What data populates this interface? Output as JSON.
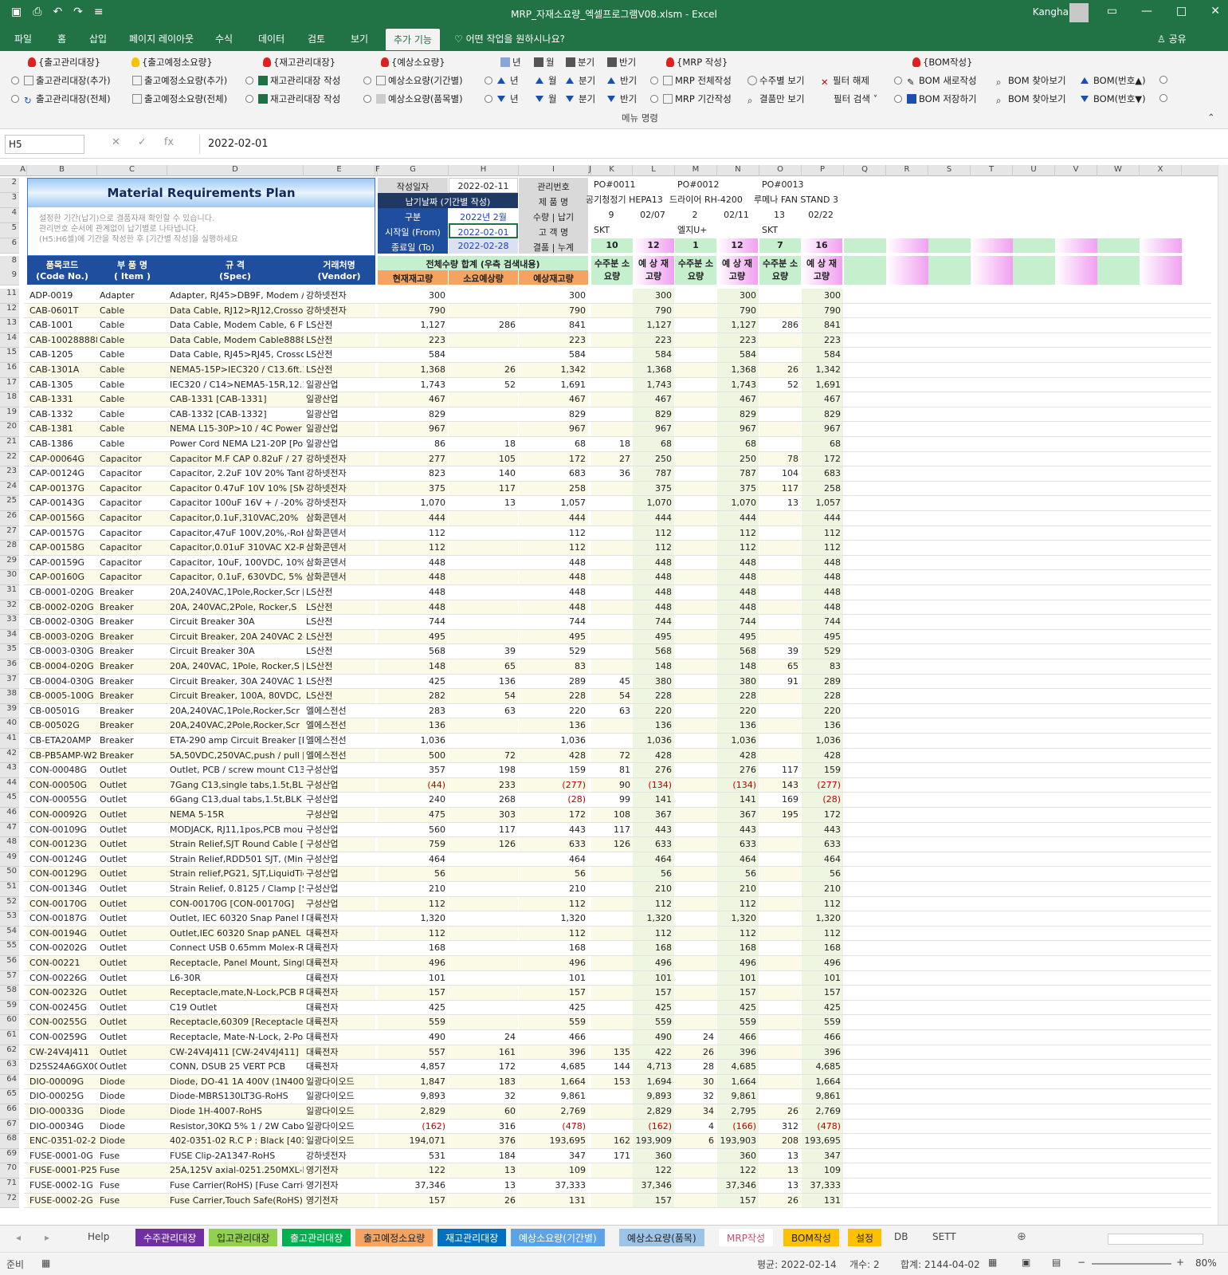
{
  "window": {
    "title": "MRP_자재소요량_엑셀프로그램V08.xlsm  -  Excel",
    "user": "Kangha"
  },
  "tabs": [
    "파일",
    "홈",
    "삽입",
    "페이지 레이아웃",
    "수식",
    "데이터",
    "검토",
    "보기",
    "추가 기능"
  ],
  "active_tab": "추가 기능",
  "tell_me": "어떤 작업을 원하시나요?",
  "share": "공유",
  "ribbon": {
    "group_label": "메뉴 명령",
    "row1": [
      "{출고관리대장}",
      "{출고예정소요량}",
      "{재고관리대장}",
      "{예상소요량}",
      "년",
      "월",
      "분기",
      "반기",
      "{MRP 작성}",
      "{BOM작성}"
    ],
    "row2": [
      "출고관리대장(추가)",
      "출고예정소요량(추가)",
      "재고관리대장 작성",
      "예상소요량(기간별)",
      "년",
      "월",
      "분기",
      "반기",
      "MRP 전체작성",
      "수주별 보기",
      "필터 해제",
      "BOM 새로작성",
      "BOM 찾아보기",
      "BOM(번호▲)"
    ],
    "row3": [
      "출고관리대장(전체)",
      "출고예정소요량(전체)",
      "재고관리대장 작성",
      "예상소요량(품목별)",
      "년",
      "월",
      "분기",
      "반기",
      "MRP 기간작성",
      "결품만 보기",
      "필터 검색 ˅",
      "BOM 저장하기",
      "BOM 찾아보기",
      "BOM(번호▼)"
    ]
  },
  "formula": {
    "name_box": "H5",
    "value": "2022-02-01"
  },
  "columns": [
    "A",
    "B",
    "C",
    "D",
    "E",
    "F",
    "G",
    "H",
    "I",
    "J",
    "K",
    "L",
    "M",
    "N",
    "O",
    "P",
    "Q",
    "R",
    "S",
    "T",
    "U",
    "V",
    "W",
    "X"
  ],
  "plan": {
    "title": "Material Requirements Plan",
    "desc1": "설정한 기간(납기)으로 결품자재 확인할 수 있습니다.",
    "desc2": "관리번호 순서에 관계없이 납기별로 나타냅니다.",
    "desc3": "(H5:H6셀)에 기간을 작성한 후 [기간별 작성]을 실행하세요",
    "created_lbl": "작성일자",
    "created": "2022-02-11",
    "period_btn": "납기날짜 (기간별 작성)",
    "kind_lbl": "구분",
    "kind": "2022년 2월",
    "from_lbl": "시작일 (From)",
    "from": "2022-02-01",
    "to_lbl": "종료일 (To)",
    "to": "2022-02-28",
    "mgmt_lbl": "관리번호",
    "prod_lbl": "제 품 명",
    "qty_lbl": "수량 | 납기",
    "cust_lbl": "고 객 명",
    "short_lbl": "결품 | 누계"
  },
  "orders": [
    {
      "po": "PO#0011",
      "product": "공기청정기 HEPA13",
      "qty": "9",
      "due": "02/07",
      "cust": "SKT",
      "short": "10",
      "cum": "12"
    },
    {
      "po": "PO#0012",
      "product": "드라이어 RH-4200",
      "qty": "2",
      "due": "02/11",
      "cust": "엘지U+",
      "short": "1",
      "cum": "12"
    },
    {
      "po": "PO#0013",
      "product": "루메나 FAN STAND 3",
      "qty": "13",
      "due": "02/22",
      "cust": "SKT",
      "short": "7",
      "cum": "16"
    }
  ],
  "headers": {
    "code": "품목코드",
    "code2": "(Code No.)",
    "item": "부 품 명",
    "item2": "( Item )",
    "spec": "규 격",
    "spec2": "(Spec)",
    "vendor": "거래처명",
    "vendor2": "(Vendor)",
    "total": "전체수량 합계 (우측 검색내용)",
    "cur": "현재재고량",
    "need": "소요예상량",
    "exp": "예상재고량",
    "ord_need1": "수주분",
    "ord_need2": "소요량",
    "ord_exp1": "예   상",
    "ord_exp2": "재고량"
  },
  "rows": [
    [
      "11",
      "ADP-0019",
      "Adapter",
      "Adapter, RJ45>DB9F, Modem / PC",
      "강하넷전자",
      "300",
      "",
      "300",
      "",
      "300",
      "",
      "300",
      "",
      "300"
    ],
    [
      "12",
      "CAB-0601T",
      "Cable",
      "Data Cable, RJ12>RJ12,Crossover",
      "강하넷전자",
      "790",
      "",
      "790",
      "",
      "790",
      "",
      "790",
      "",
      "790"
    ],
    [
      "13",
      "CAB-1001",
      "Cable",
      "Data Cable, Modem Cable, 6 Ft, [",
      "LS산전",
      "1,127",
      "286",
      "841",
      "",
      "1,127",
      "",
      "1,127",
      "286",
      "841"
    ],
    [
      "14",
      "CAB-1002888888",
      "Cable",
      "Data Cable, Modem Cable888888",
      "LS산전",
      "223",
      "",
      "223",
      "",
      "223",
      "",
      "223",
      "",
      "223"
    ],
    [
      "15",
      "CAB-1205",
      "Cable",
      "Data Cable, RJ45>RJ45, Crossove",
      "LS산전",
      "584",
      "",
      "584",
      "",
      "584",
      "",
      "584",
      "",
      "584"
    ],
    [
      "16",
      "CAB-1301A",
      "Cable",
      "NEMA5-15P>IEC320 / C13.6ft.10A",
      "LS산전",
      "1,368",
      "26",
      "1,342",
      "",
      "1,368",
      "",
      "1,368",
      "26",
      "1,342"
    ],
    [
      "17",
      "CAB-1305",
      "Cable",
      "IEC320 / C14>NEMA5-15R,12.10A",
      "일광산업",
      "1,743",
      "52",
      "1,691",
      "",
      "1,743",
      "",
      "1,743",
      "52",
      "1,691"
    ],
    [
      "18",
      "CAB-1331",
      "Cable",
      "CAB-1331 [CAB-1331]",
      "일광산업",
      "467",
      "",
      "467",
      "",
      "467",
      "",
      "467",
      "",
      "467"
    ],
    [
      "19",
      "CAB-1332",
      "Cable",
      "CAB-1332 [CAB-1332]",
      "일광산업",
      "829",
      "",
      "829",
      "",
      "829",
      "",
      "829",
      "",
      "829"
    ],
    [
      "20",
      "CAB-1381",
      "Cable",
      "NEMA L15-30P>10 / 4C Power Co",
      "일광산업",
      "967",
      "",
      "967",
      "",
      "967",
      "",
      "967",
      "",
      "967"
    ],
    [
      "21",
      "CAB-1386",
      "Cable",
      "Power Cord NEMA L21-20P [Powe",
      "일광산업",
      "86",
      "18",
      "68",
      "18",
      "68",
      "",
      "68",
      "",
      "68"
    ],
    [
      "22",
      "CAP-00064G",
      "Capacitor",
      "Capacitor M.F CAP 0.82uF / 275V-",
      "강하넷전자",
      "277",
      "105",
      "172",
      "27",
      "250",
      "",
      "250",
      "78",
      "172"
    ],
    [
      "23",
      "CAP-00124G",
      "Capacitor",
      "Capacitor, 2.2uF 10V 20% Tantalu",
      "강하넷전자",
      "823",
      "140",
      "683",
      "36",
      "787",
      "",
      "787",
      "104",
      "683"
    ],
    [
      "24",
      "CAP-00137G",
      "Capacitor",
      "Capacitor 0.47uF 10V 10% [SMT0",
      "강하넷전자",
      "375",
      "117",
      "258",
      "",
      "375",
      "",
      "375",
      "117",
      "258"
    ],
    [
      "25",
      "CAP-00143G",
      "Capacitor",
      "Capacitor 100uF 16V + / -20% 10",
      "강하넷전자",
      "1,070",
      "13",
      "1,057",
      "",
      "1,070",
      "",
      "1,070",
      "13",
      "1,057"
    ],
    [
      "26",
      "CAP-00156G",
      "Capacitor",
      "Capacitor,0.1uF,310VAC,20%",
      "삼화콘덴서",
      "444",
      "",
      "444",
      "",
      "444",
      "",
      "444",
      "",
      "444"
    ],
    [
      "27",
      "CAP-00157G",
      "Capacitor",
      "Capacitor,47uF 100V,20%,-RoHS",
      "삼화콘덴서",
      "112",
      "",
      "112",
      "",
      "112",
      "",
      "112",
      "",
      "112"
    ],
    [
      "28",
      "CAP-00158G",
      "Capacitor",
      "Capacitor,0.01uF 310VAC X2-RoH",
      "삼화콘덴서",
      "112",
      "",
      "112",
      "",
      "112",
      "",
      "112",
      "",
      "112"
    ],
    [
      "29",
      "CAP-00159G",
      "Capacitor",
      "Capacitor, 10uF, 100VDC, 10%, M",
      "삼화콘덴서",
      "448",
      "",
      "448",
      "",
      "448",
      "",
      "448",
      "",
      "448"
    ],
    [
      "30",
      "CAP-00160G",
      "Capacitor",
      "Capacitor, 0.1uF, 630VDC, 5%, Me",
      "삼화콘덴서",
      "448",
      "",
      "448",
      "",
      "448",
      "",
      "448",
      "",
      "448"
    ],
    [
      "31",
      "CB-0001-020G",
      "Breaker",
      "20A,240VAC,1Pole,Rocker,Scr [20A",
      "LS산전",
      "448",
      "",
      "448",
      "",
      "448",
      "",
      "448",
      "",
      "448"
    ],
    [
      "32",
      "CB-0002-020G",
      "Breaker",
      "20A, 240VAC,2Pole, Rocker,S",
      "LS산전",
      "448",
      "",
      "448",
      "",
      "448",
      "",
      "448",
      "",
      "448"
    ],
    [
      "33",
      "CB-0002-030G",
      "Breaker",
      "Circuit Breaker 30A",
      "LS산전",
      "744",
      "",
      "744",
      "",
      "744",
      "",
      "744",
      "",
      "744"
    ],
    [
      "34",
      "CB-0003-020G",
      "Breaker",
      "Circuit Breaker, 20A 240VAC 2-Po",
      "LS산전",
      "495",
      "",
      "495",
      "",
      "495",
      "",
      "495",
      "",
      "495"
    ],
    [
      "35",
      "CB-0003-030G",
      "Breaker",
      "Circuit Breaker 30A",
      "LS산전",
      "568",
      "39",
      "529",
      "",
      "568",
      "",
      "568",
      "39",
      "529"
    ],
    [
      "36",
      "CB-0004-020G",
      "Breaker",
      "20A, 240VAC, 1Pole, Rocker,S [20A",
      "LS산전",
      "148",
      "65",
      "83",
      "",
      "148",
      "",
      "148",
      "65",
      "83"
    ],
    [
      "37",
      "CB-0004-030G",
      "Breaker",
      "Circuit Breaker, 30A 240VAC 1-Po",
      "LS산전",
      "425",
      "136",
      "289",
      "45",
      "380",
      "",
      "380",
      "91",
      "289"
    ],
    [
      "38",
      "CB-0005-100G",
      "Breaker",
      "Circuit Breaker, 100A, 80VDC, 1 P",
      "LS산전",
      "282",
      "54",
      "228",
      "54",
      "228",
      "",
      "228",
      "",
      "228"
    ],
    [
      "39",
      "CB-00501G",
      "Breaker",
      "20A,240VAC,1Pole,Rocker,Scr",
      "엘에스전선",
      "283",
      "63",
      "220",
      "63",
      "220",
      "",
      "220",
      "",
      "220"
    ],
    [
      "40",
      "CB-00502G",
      "Breaker",
      "20A,240VAC,2Pole,Rocker,Scr",
      "엘에스전선",
      "136",
      "",
      "136",
      "",
      "136",
      "",
      "136",
      "",
      "136"
    ],
    [
      "41",
      "CB-ETA20AMP",
      "Breaker",
      "ETA-290 amp Circuit Breaker [ETA",
      "엘에스전선",
      "1,036",
      "",
      "1,036",
      "",
      "1,036",
      "",
      "1,036",
      "",
      "1,036"
    ],
    [
      "42",
      "CB-PB5AMP-W23",
      "Breaker",
      "5A,50VDC,250VAC,push / pull [Circ",
      "엘에스전선",
      "500",
      "72",
      "428",
      "72",
      "428",
      "",
      "428",
      "",
      "428"
    ],
    [
      "43",
      "CON-00048G",
      "Outlet",
      "Outlet, PCB / screw mount C13,10",
      "구성산업",
      "357",
      "198",
      "159",
      "81",
      "276",
      "",
      "276",
      "117",
      "159"
    ],
    [
      "44",
      "CON-00050G",
      "Outlet",
      "7Gang C13,single tabs,1.5t,BL [CO",
      "구성산업",
      "(44)",
      "233",
      "(277)",
      "90",
      "(134)",
      "",
      "(134)",
      "143",
      "(277)"
    ],
    [
      "45",
      "CON-00055G",
      "Outlet",
      "6Gang C13,dual tabs,1.5t,BLK [CO",
      "구성산업",
      "240",
      "268",
      "(28)",
      "99",
      "141",
      "",
      "141",
      "169",
      "(28)"
    ],
    [
      "46",
      "CON-00092G",
      "Outlet",
      "NEMA 5-15R",
      "구성산업",
      "475",
      "303",
      "172",
      "108",
      "367",
      "",
      "367",
      "195",
      "172"
    ],
    [
      "47",
      "CON-00109G",
      "Outlet",
      "MODJACK, RJ11,1pos,PCB mount-",
      "구성산업",
      "560",
      "117",
      "443",
      "117",
      "443",
      "",
      "443",
      "",
      "443"
    ],
    [
      "48",
      "CON-00123G",
      "Outlet",
      "Strain Relief,SJT Round Cable [CO",
      "구성산업",
      "759",
      "126",
      "633",
      "126",
      "633",
      "",
      "633",
      "",
      "633"
    ],
    [
      "49",
      "CON-00124G",
      "Outlet",
      "Strain Relief,RDD501 SJT, (Min Dia",
      "구성산업",
      "464",
      "",
      "464",
      "",
      "464",
      "",
      "464",
      "",
      "464"
    ],
    [
      "50",
      "CON-00129G",
      "Outlet",
      "Strain relief,PG21, SJT,LiquidTight,",
      "구성산업",
      "56",
      "",
      "56",
      "",
      "56",
      "",
      "56",
      "",
      "56"
    ],
    [
      "51",
      "CON-00134G",
      "Outlet",
      "Strain Relief, 0.8125 / Clamp [Stra",
      "구성산업",
      "210",
      "",
      "210",
      "",
      "210",
      "",
      "210",
      "",
      "210"
    ],
    [
      "52",
      "CON-00170G",
      "Outlet",
      "CON-00170G [CON-00170G]",
      "구성산업",
      "112",
      "",
      "112",
      "",
      "112",
      "",
      "112",
      "",
      "112"
    ],
    [
      "53",
      "CON-00187G",
      "Outlet",
      "Outlet, IEC 60320 Snap Panel Mo",
      "대륙전자",
      "1,320",
      "",
      "1,320",
      "",
      "1,320",
      "",
      "1,320",
      "",
      "1,320"
    ],
    [
      "54",
      "CON-00194G",
      "Outlet",
      "Outlet,IEC 60320 Snap pANEL [R3",
      "대륙전자",
      "112",
      "",
      "112",
      "",
      "112",
      "",
      "112",
      "",
      "112"
    ],
    [
      "55",
      "CON-00202G",
      "Outlet",
      "Connect USB 0.65mm Molex-RoH",
      "대륙전자",
      "168",
      "",
      "168",
      "",
      "168",
      "",
      "168",
      "",
      "168"
    ],
    [
      "56",
      "CON-00221",
      "Outlet",
      "Receptacle, Panel Mount, Single, .",
      "대륙전자",
      "496",
      "",
      "496",
      "",
      "496",
      "",
      "496",
      "",
      "496"
    ],
    [
      "57",
      "CON-00226G",
      "Outlet",
      "L6-30R",
      "대륙전자",
      "101",
      "",
      "101",
      "",
      "101",
      "",
      "101",
      "",
      "101"
    ],
    [
      "58",
      "CON-00232G",
      "Outlet",
      "Receptacle,mate,N-Lock,PCB Righ",
      "대륙전자",
      "157",
      "",
      "157",
      "",
      "157",
      "",
      "157",
      "",
      "157"
    ],
    [
      "59",
      "CON-00245G",
      "Outlet",
      "C19 Outlet",
      "대륙전자",
      "425",
      "",
      "425",
      "",
      "425",
      "",
      "425",
      "",
      "425"
    ],
    [
      "60",
      "CON-00255G",
      "Outlet",
      "Receptacle,60309 [Receptacle,603",
      "대륙전자",
      "559",
      "",
      "559",
      "",
      "559",
      "",
      "559",
      "",
      "559"
    ],
    [
      "61",
      "CON-00259G",
      "Outlet",
      "Receptacle, Mate-N-Lock, 2-Posit",
      "대륙전자",
      "490",
      "24",
      "466",
      "",
      "490",
      "24",
      "466",
      "",
      "466"
    ],
    [
      "62",
      "CW-24V4J411",
      "Outlet",
      "CW-24V4J411 [CW-24V4J411]",
      "대륙전자",
      "557",
      "161",
      "396",
      "135",
      "422",
      "26",
      "396",
      "",
      "396"
    ],
    [
      "63",
      "D25S24A6GX00LF",
      "Outlet",
      "CONN, DSUB 25 VERT PCB",
      "대륙전자",
      "4,857",
      "172",
      "4,685",
      "144",
      "4,713",
      "28",
      "4,685",
      "",
      "4,685"
    ],
    [
      "64",
      "DIO-00009G",
      "Diode",
      "Diode, DO-41 1A 400V (1N4004)-",
      "일광다이오드",
      "1,847",
      "183",
      "1,664",
      "153",
      "1,694",
      "30",
      "1,664",
      "",
      "1,664"
    ],
    [
      "65",
      "DIO-00025G",
      "Diode",
      "Diode-MBRS130LT3G-RoHS",
      "일광다이오드",
      "9,893",
      "32",
      "9,861",
      "",
      "9,893",
      "32",
      "9,861",
      "",
      "9,861"
    ],
    [
      "66",
      "DIO-00033G",
      "Diode",
      "Diode 1H-4007-RoHS",
      "일광다이오드",
      "2,829",
      "60",
      "2,769",
      "",
      "2,829",
      "34",
      "2,795",
      "26",
      "2,769"
    ],
    [
      "67",
      "DIO-00034G",
      "Diode",
      "Resistor,30KΩ 5% 1 / 2W Cabon",
      "일광다이오드",
      "(162)",
      "316",
      "(478)",
      "",
      "(162)",
      "4",
      "(166)",
      "312",
      "(478)"
    ],
    [
      "68",
      "ENC-0351-02-21",
      "Diode",
      "402-0351-02 R.C P : Black [403-0",
      "일광다이오드",
      "194,071",
      "376",
      "193,695",
      "162",
      "193,909",
      "6",
      "193,903",
      "208",
      "193,695"
    ],
    [
      "69",
      "FUSE-0001-0G",
      "Fuse",
      "FUSE Clip-2A1347-RoHS",
      "강하넷전자",
      "531",
      "184",
      "347",
      "171",
      "360",
      "",
      "360",
      "13",
      "347"
    ],
    [
      "70",
      "FUSE-0001-P25",
      "Fuse",
      "25A,125V axial-0251.250MXL-RoH",
      "영기전자",
      "122",
      "13",
      "109",
      "",
      "122",
      "",
      "122",
      "13",
      "109"
    ],
    [
      "71",
      "FUSE-0002-1G",
      "Fuse",
      "Fuse Carrier(RoHS) [Fuse Carrier]",
      "영기전자",
      "37,346",
      "13",
      "37,333",
      "",
      "37,346",
      "",
      "37,346",
      "13",
      "37,333"
    ],
    [
      "72",
      "FUSE-0002-2G",
      "Fuse",
      "Fuse Carrier,Touch Safe(RoHS) [Fu",
      "영기전자",
      "157",
      "26",
      "131",
      "",
      "157",
      "",
      "157",
      "26",
      "131"
    ]
  ],
  "sheets": [
    {
      "name": "Help",
      "color": "#f3f3f3",
      "fg": "#444"
    },
    {
      "name": "수주관리대장",
      "color": "#7030a0",
      "fg": "#fff"
    },
    {
      "name": "입고관리대장",
      "color": "#92d050",
      "fg": "#222"
    },
    {
      "name": "출고관리대장",
      "color": "#00b050",
      "fg": "#fff"
    },
    {
      "name": "출고예정소요량",
      "color": "#f4a460",
      "fg": "#222"
    },
    {
      "name": "재고관리대장",
      "color": "#0070c0",
      "fg": "#fff"
    },
    {
      "name": "예상소요량(기간별)",
      "color": "#5ba3e6",
      "fg": "#fff"
    },
    {
      "name": "예상소요량(품목)",
      "color": "#9dc3e6",
      "fg": "#222"
    },
    {
      "name": "MRP작성",
      "color": "#ffffff",
      "fg": "#c05078"
    },
    {
      "name": "BOM작성",
      "color": "#ffc000",
      "fg": "#222"
    },
    {
      "name": "설정",
      "color": "#ffc000",
      "fg": "#222"
    },
    {
      "name": "DB",
      "color": "#f3f3f3",
      "fg": "#444"
    },
    {
      "name": "SETT",
      "color": "#f3f3f3",
      "fg": "#444"
    }
  ],
  "status": {
    "ready": "준비",
    "avg": "평균: 2022-02-14",
    "count": "개수: 2",
    "sum": "합계: 2144-04-02",
    "zoom": "80%"
  }
}
